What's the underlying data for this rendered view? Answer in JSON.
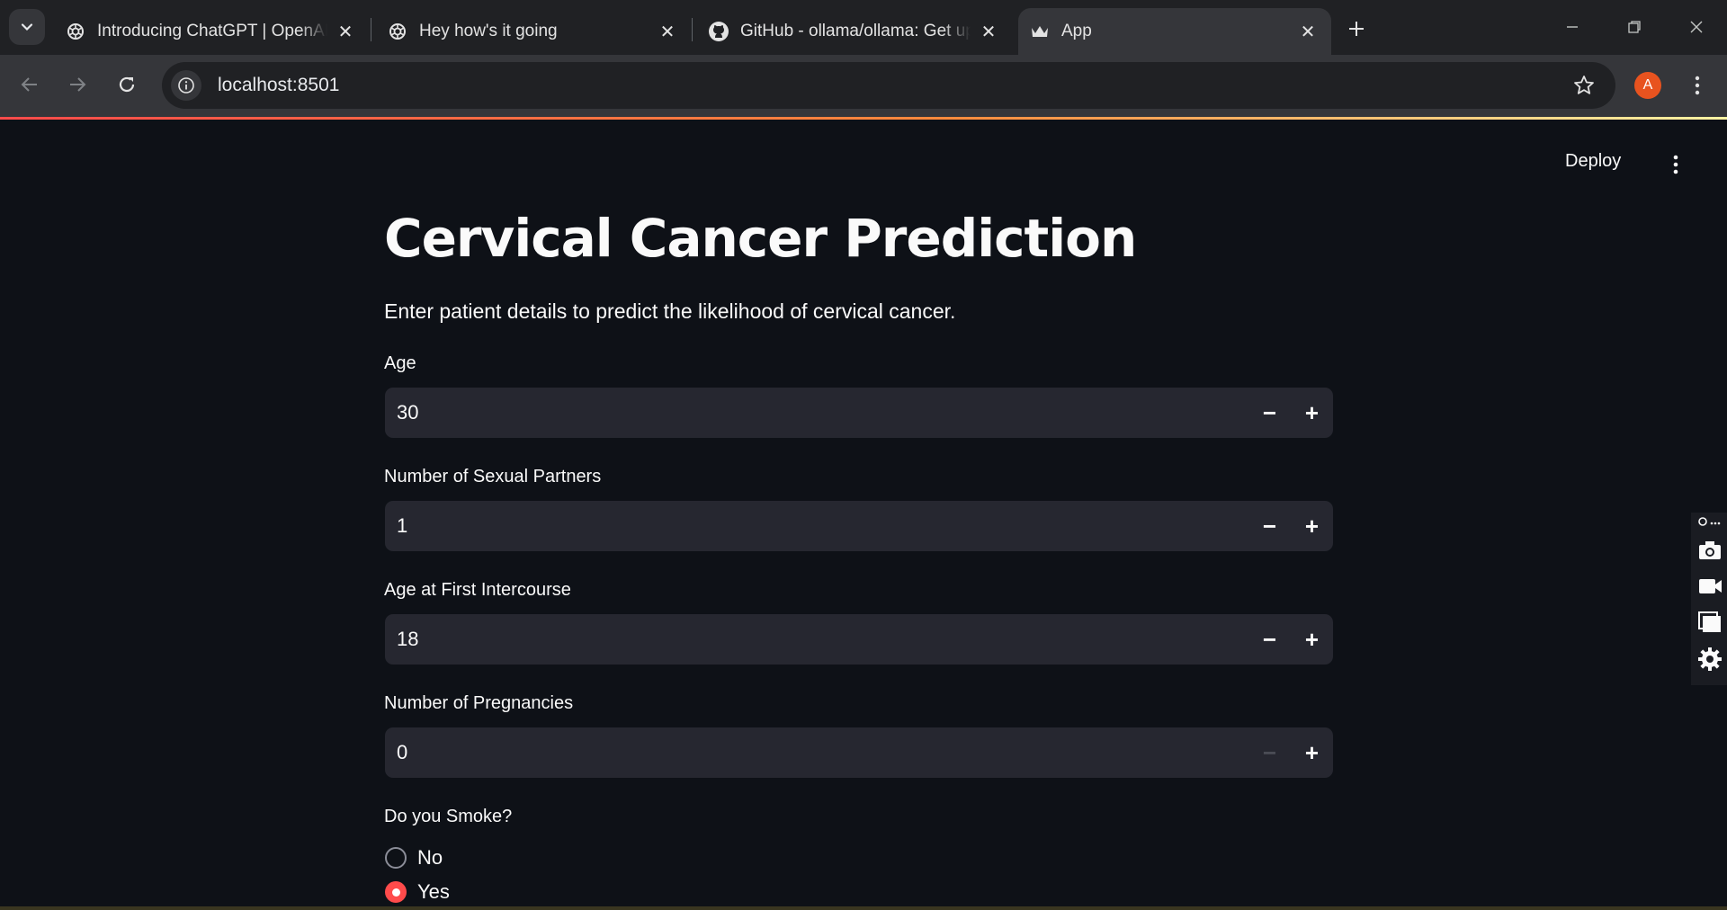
{
  "browser": {
    "tabs": [
      {
        "title": "Introducing ChatGPT | OpenAI",
        "favicon": "openai-icon",
        "active": false
      },
      {
        "title": "Hey how's it going",
        "favicon": "openai-icon",
        "active": false
      },
      {
        "title": "GitHub - ollama/ollama: Get up and running",
        "favicon": "github-icon",
        "active": false
      },
      {
        "title": "App",
        "favicon": "streamlit-crown-icon",
        "active": true
      }
    ],
    "address": "localhost:8501",
    "profile_initial": "A",
    "colors": {
      "tabstrip": "#202124",
      "toolbar": "#35363a",
      "profile": "#e8531f"
    }
  },
  "app": {
    "deploy_label": "Deploy",
    "title": "Cervical Cancer Prediction",
    "intro": "Enter patient details to predict the likelihood of cervical cancer.",
    "fields": [
      {
        "label": "Age",
        "value": "30",
        "minus_enabled": true
      },
      {
        "label": "Number of Sexual Partners",
        "value": "1",
        "minus_enabled": true
      },
      {
        "label": "Age at First Intercourse",
        "value": "18",
        "minus_enabled": true
      },
      {
        "label": "Number of Pregnancies",
        "value": "0",
        "minus_enabled": false
      }
    ],
    "smoke": {
      "label": "Do you Smoke?",
      "options": [
        "No",
        "Yes"
      ],
      "selected": "Yes"
    },
    "colors": {
      "background": "#0e1117",
      "input": "#262730",
      "accent": "#ff4b4b"
    }
  }
}
